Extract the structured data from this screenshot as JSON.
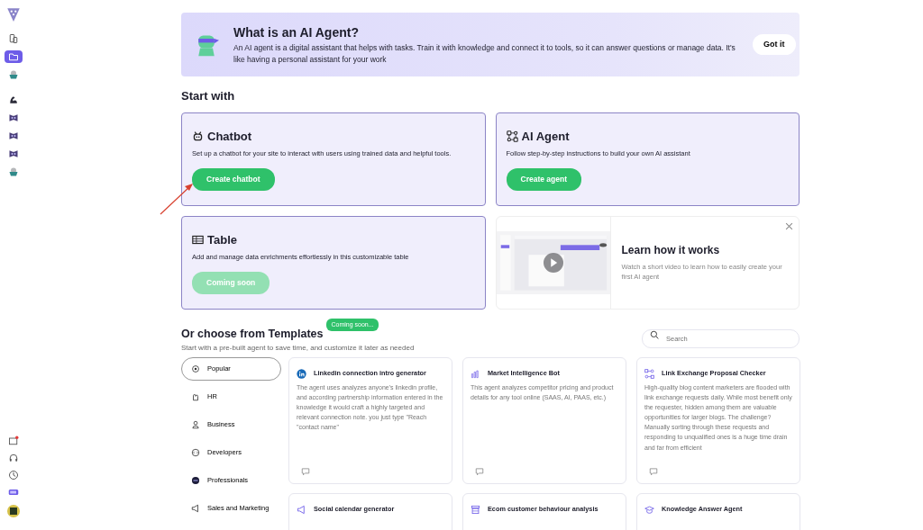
{
  "sidebar": {
    "items": [
      {
        "kind": "pages",
        "selected": false
      },
      {
        "kind": "folder",
        "selected": true
      },
      {
        "kind": "bowl",
        "selected": false
      },
      {
        "kind": "arm",
        "selected": false
      },
      {
        "kind": "bot",
        "selected": false
      },
      {
        "kind": "bot",
        "selected": false
      },
      {
        "kind": "bot",
        "selected": false
      },
      {
        "kind": "bowl",
        "selected": false
      }
    ],
    "bottom_items": [
      {
        "kind": "mail"
      },
      {
        "kind": "headset"
      },
      {
        "kind": "clock"
      },
      {
        "kind": "battery"
      },
      {
        "kind": "avatar"
      }
    ]
  },
  "banner": {
    "title": "What is an AI Agent?",
    "text": "An AI agent is a digital assistant that helps with tasks. Train it with knowledge and connect it to tools, so it can answer questions or manage data. It's like having a personal assistant for your work",
    "button": "Got it"
  },
  "start_with": {
    "heading": "Start with",
    "cards": [
      {
        "kind": "chatbot",
        "title": "Chatbot",
        "text": "Set up a chatbot for your site to interact with users using trained data and helpful tools.",
        "button": "Create chatbot",
        "disabled": false
      },
      {
        "kind": "agent",
        "title": "AI Agent",
        "text": "Follow step-by-step instructions to build your own AI assistant",
        "button": "Create agent",
        "disabled": false
      },
      {
        "kind": "table",
        "title": "Table",
        "text": "Add and manage data enrichments effortlessly in this customizable table",
        "button": "Coming soon",
        "disabled": true
      }
    ],
    "video": {
      "title": "Learn how it works",
      "text": "Watch a short video to learn how to easily create your first AI agent"
    }
  },
  "templates": {
    "heading": "Or choose from Templates",
    "badge": "Coming soon...",
    "subtitle": "Start with a pre-built agent to save time, and customize it later as needed",
    "search": {
      "placeholder": "Search"
    },
    "categories": [
      {
        "kind": "popular",
        "label": "Popular",
        "selected": true
      },
      {
        "kind": "hr",
        "label": "HR",
        "selected": false
      },
      {
        "kind": "business",
        "label": "Business",
        "selected": false
      },
      {
        "kind": "developers",
        "label": "Developers",
        "selected": false
      },
      {
        "kind": "professionals",
        "label": "Professionals",
        "selected": false
      },
      {
        "kind": "sales",
        "label": "Sales and Marketing",
        "selected": false
      }
    ],
    "cards": [
      {
        "kind": "linkedin",
        "title": "Linkedin connection intro generator",
        "text": "The agent uses analyzes anyone's linkedin profile, and according partnership information entered in the knowledge it would craft a highly targeted and relevant connection note. you just type \"Reach \"contact name\""
      },
      {
        "kind": "chart",
        "title": "Market Intelligence Bot",
        "text": "This agent analyzes competitor pricing and product details for any tool online (SAAS, AI, PAAS, etc.)"
      },
      {
        "kind": "flow",
        "title": "Link Exchange Proposal Checker",
        "text": "High-quality blog content marketers are flooded with link exchange requests daily. While most benefit only the requester, hidden among them are valuable opportunities for larger blogs. The challenge? Manually sorting through these requests and responding to unqualified ones is a huge time drain and far from efficient"
      },
      {
        "kind": "megaphone",
        "title": "Social calendar generator"
      },
      {
        "kind": "store",
        "title": "Ecom customer behaviour analysis"
      },
      {
        "kind": "cap",
        "title": "Knowledge Answer Agent"
      }
    ]
  }
}
